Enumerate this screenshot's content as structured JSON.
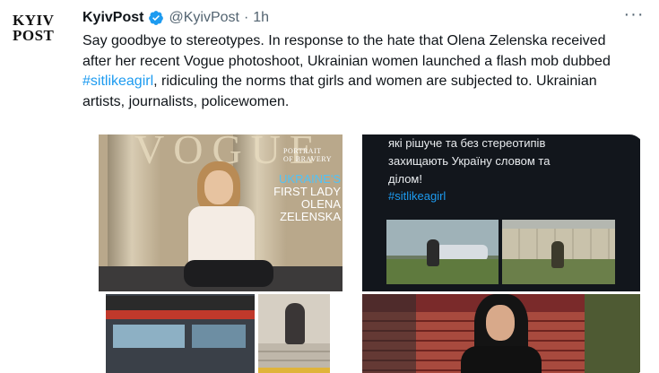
{
  "account": {
    "avatar_line1": "KYIV",
    "avatar_line2": "POST",
    "name": "KyivPost",
    "handle": "@KyivPost",
    "separator": "·",
    "time": "1h",
    "more_icon": "more-icon"
  },
  "tweet": {
    "text_before": "Say goodbye to stereotypes. In response to the hate that Olena Zelenska received after her recent Vogue photoshoot, Ukrainian women launched a flash mob dubbed ",
    "hashtag": "#sitlikeagirl",
    "text_after": ", ridiculing the norms that girls and women are subjected to. Ukrainian artists, journalists, policewomen."
  },
  "media": {
    "cover": {
      "portrait_line1": "PORTRAIT",
      "portrait_line2": "OF BRAVERY",
      "headline_blue": "UKRAINE'S",
      "headline_white_1": "FIRST LADY",
      "headline_white_2": "OLENA",
      "headline_white_3": "ZELENSKA"
    },
    "post": {
      "line1": "які рішуче та без стереотипів",
      "line2": "захищають Україну словом та",
      "line3": "ділом!",
      "hashtag": "#sitlikeagirl"
    }
  },
  "colors": {
    "link": "#1d9bf0",
    "text": "#0f1419",
    "secondary": "#536471"
  }
}
